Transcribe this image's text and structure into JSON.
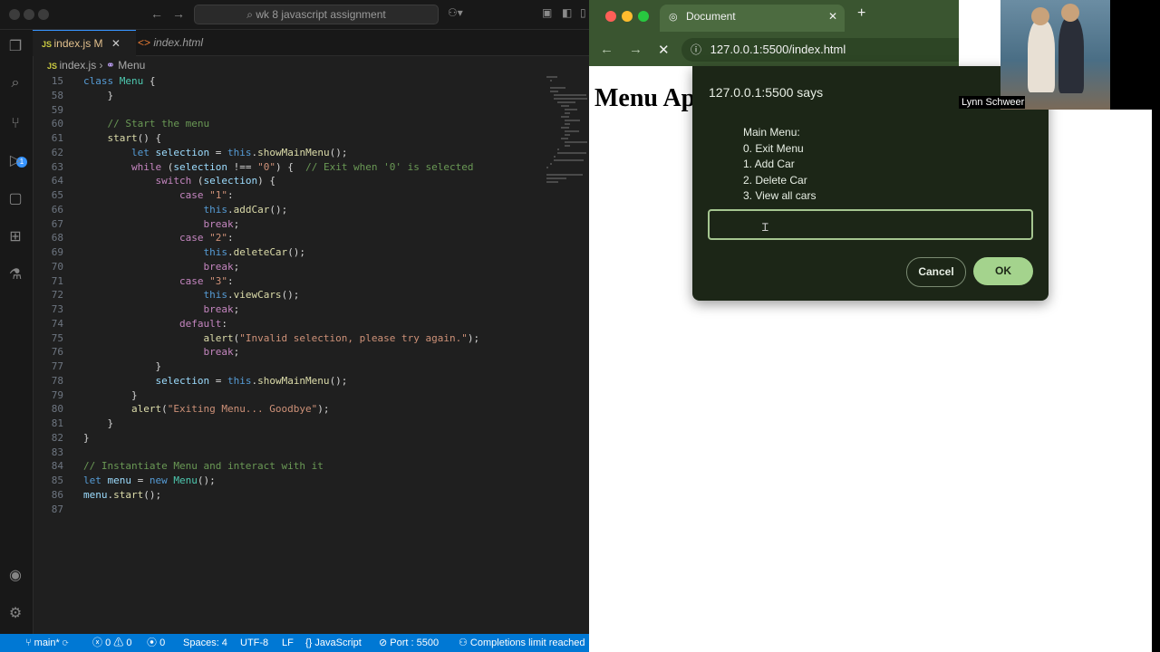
{
  "vscode": {
    "search_text": "wk 8 javascript assignment",
    "tabs": [
      {
        "label": "index.js",
        "badge": "M",
        "active": true
      },
      {
        "label": "index.html",
        "active": false
      }
    ],
    "breadcrumb": {
      "file": "index.js",
      "symbol": "Menu"
    },
    "scm_badge": "1",
    "code_lines": [
      {
        "n": "15",
        "tokens": [
          [
            "kw",
            "class "
          ],
          [
            "cls",
            "Menu "
          ],
          [
            "pun",
            "{"
          ]
        ]
      },
      {
        "n": "58",
        "tokens": [
          [
            "pun",
            "    }"
          ]
        ]
      },
      {
        "n": "59",
        "tokens": []
      },
      {
        "n": "60",
        "tokens": [
          [
            "cm",
            "    // Start the menu"
          ]
        ]
      },
      {
        "n": "61",
        "tokens": [
          [
            "fn",
            "    start"
          ],
          [
            "pun",
            "() {"
          ]
        ]
      },
      {
        "n": "62",
        "tokens": [
          [
            "kw",
            "        let "
          ],
          [
            "var",
            "selection"
          ],
          [
            "pun",
            " = "
          ],
          [
            "kw",
            "this"
          ],
          [
            "pun",
            "."
          ],
          [
            "fn",
            "showMainMenu"
          ],
          [
            "pun",
            "();"
          ]
        ]
      },
      {
        "n": "63",
        "tokens": [
          [
            "ctl",
            "        while "
          ],
          [
            "pun",
            "("
          ],
          [
            "var",
            "selection"
          ],
          [
            "pun",
            " !== "
          ],
          [
            "str",
            "\"0\""
          ],
          [
            "pun",
            ") {  "
          ],
          [
            "cm",
            "// Exit when '0' is selected"
          ]
        ]
      },
      {
        "n": "64",
        "tokens": [
          [
            "ctl",
            "            switch "
          ],
          [
            "pun",
            "("
          ],
          [
            "var",
            "selection"
          ],
          [
            "pun",
            ") {"
          ]
        ]
      },
      {
        "n": "65",
        "tokens": [
          [
            "ctl",
            "                case "
          ],
          [
            "str",
            "\"1\""
          ],
          [
            "pun",
            ":"
          ]
        ]
      },
      {
        "n": "66",
        "tokens": [
          [
            "kw",
            "                    this"
          ],
          [
            "pun",
            "."
          ],
          [
            "fn",
            "addCar"
          ],
          [
            "pun",
            "();"
          ]
        ]
      },
      {
        "n": "67",
        "tokens": [
          [
            "ctl",
            "                    break"
          ],
          [
            "pun",
            ";"
          ]
        ]
      },
      {
        "n": "68",
        "tokens": [
          [
            "ctl",
            "                case "
          ],
          [
            "str",
            "\"2\""
          ],
          [
            "pun",
            ":"
          ]
        ]
      },
      {
        "n": "69",
        "tokens": [
          [
            "kw",
            "                    this"
          ],
          [
            "pun",
            "."
          ],
          [
            "fn",
            "deleteCar"
          ],
          [
            "pun",
            "();"
          ]
        ]
      },
      {
        "n": "70",
        "tokens": [
          [
            "ctl",
            "                    break"
          ],
          [
            "pun",
            ";"
          ]
        ]
      },
      {
        "n": "71",
        "tokens": [
          [
            "ctl",
            "                case "
          ],
          [
            "str",
            "\"3\""
          ],
          [
            "pun",
            ":"
          ]
        ]
      },
      {
        "n": "72",
        "tokens": [
          [
            "kw",
            "                    this"
          ],
          [
            "pun",
            "."
          ],
          [
            "fn",
            "viewCars"
          ],
          [
            "pun",
            "();"
          ]
        ]
      },
      {
        "n": "73",
        "tokens": [
          [
            "ctl",
            "                    break"
          ],
          [
            "pun",
            ";"
          ]
        ]
      },
      {
        "n": "74",
        "tokens": [
          [
            "ctl",
            "                default"
          ],
          [
            "pun",
            ":"
          ]
        ]
      },
      {
        "n": "75",
        "tokens": [
          [
            "fn",
            "                    alert"
          ],
          [
            "pun",
            "("
          ],
          [
            "str",
            "\"Invalid selection, please try again.\""
          ],
          [
            "pun",
            ");"
          ]
        ]
      },
      {
        "n": "76",
        "tokens": [
          [
            "ctl",
            "                    break"
          ],
          [
            "pun",
            ";"
          ]
        ]
      },
      {
        "n": "77",
        "tokens": [
          [
            "pun",
            "            }"
          ]
        ]
      },
      {
        "n": "78",
        "tokens": [
          [
            "var",
            "            selection"
          ],
          [
            "pun",
            " = "
          ],
          [
            "kw",
            "this"
          ],
          [
            "pun",
            "."
          ],
          [
            "fn",
            "showMainMenu"
          ],
          [
            "pun",
            "();"
          ]
        ]
      },
      {
        "n": "79",
        "tokens": [
          [
            "pun",
            "        }"
          ]
        ]
      },
      {
        "n": "80",
        "tokens": [
          [
            "fn",
            "        alert"
          ],
          [
            "pun",
            "("
          ],
          [
            "str",
            "\"Exiting Menu... Goodbye\""
          ],
          [
            "pun",
            ");"
          ]
        ]
      },
      {
        "n": "81",
        "tokens": [
          [
            "pun",
            "    }"
          ]
        ]
      },
      {
        "n": "82",
        "tokens": [
          [
            "pun",
            "}"
          ]
        ]
      },
      {
        "n": "83",
        "tokens": []
      },
      {
        "n": "84",
        "tokens": [
          [
            "cm",
            "// Instantiate Menu and interact with it"
          ]
        ]
      },
      {
        "n": "85",
        "tokens": [
          [
            "kw",
            "let "
          ],
          [
            "var",
            "menu"
          ],
          [
            "pun",
            " = "
          ],
          [
            "kw",
            "new "
          ],
          [
            "cls",
            "Menu"
          ],
          [
            "pun",
            "();"
          ]
        ]
      },
      {
        "n": "86",
        "tokens": [
          [
            "var",
            "menu"
          ],
          [
            "pun",
            "."
          ],
          [
            "fn",
            "start"
          ],
          [
            "pun",
            "();"
          ]
        ]
      },
      {
        "n": "87",
        "tokens": []
      }
    ],
    "status": {
      "branch": "main*",
      "errors": "0",
      "warnings": "0",
      "ports": "0",
      "spaces": "Spaces: 4",
      "encoding": "UTF-8",
      "eol": "LF",
      "language": "JavaScript",
      "port": "Port : 5500",
      "completions": "Completions limit reached"
    }
  },
  "browser": {
    "tab_title": "Document",
    "url": "127.0.0.1:5500/index.html",
    "page_heading": "Menu Ap",
    "dialog": {
      "title": "127.0.0.1:5500 says",
      "message_lines": [
        "Main Menu:",
        "0. Exit Menu",
        "1. Add Car",
        "2. Delete Car",
        "3. View all cars"
      ],
      "input_value": "",
      "cancel_label": "Cancel",
      "ok_label": "OK"
    }
  },
  "video": {
    "participant_name": "Lynn Schweer"
  }
}
